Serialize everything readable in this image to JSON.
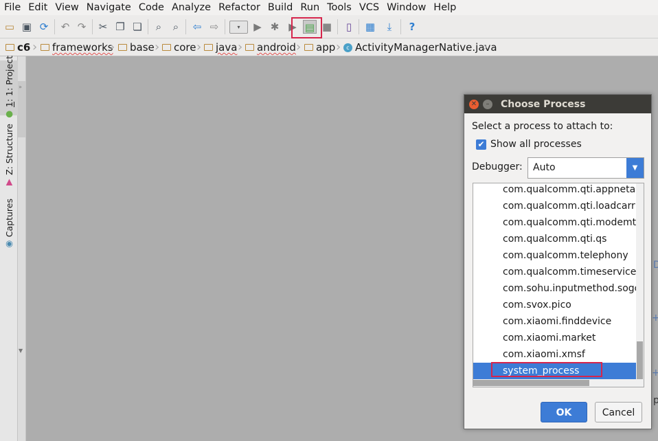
{
  "menu": [
    "File",
    "Edit",
    "View",
    "Navigate",
    "Code",
    "Analyze",
    "Refactor",
    "Build",
    "Run",
    "Tools",
    "VCS",
    "Window",
    "Help"
  ],
  "toolbar_icons": [
    "open-folder-icon",
    "save-icon",
    "sync-icon",
    "undo-icon",
    "redo-icon",
    "cut-icon",
    "copy-icon",
    "paste-icon",
    "find-icon",
    "replace-icon",
    "back-icon",
    "forward-icon",
    "run-config-dropdown",
    "run-icon",
    "debug-icon",
    "run-coverage-icon",
    "attach-debugger-icon",
    "stop-icon",
    "avd-manager-icon",
    "project-structure-icon",
    "sdk-manager-icon",
    "help-icon"
  ],
  "breadcrumbs": [
    "c6",
    "frameworks",
    "base",
    "core",
    "java",
    "android",
    "app",
    "ActivityManagerNative.java"
  ],
  "side_tabs": [
    "1: Project",
    "Z: Structure",
    "Captures"
  ],
  "dialog": {
    "title": "Choose Process",
    "select_label": "Select a process to attach to:",
    "show_all_label": "Show all processes",
    "show_all_checked": true,
    "debugger_label": "Debugger:",
    "debugger_value": "Auto",
    "processes": [
      "com.qualcomm.qti.appnetaccess",
      "com.qualcomm.qti.loadcarrier",
      "com.qualcomm.qti.modemtestmode",
      "com.qualcomm.qti.qs",
      "com.qualcomm.telephony",
      "com.qualcomm.timeservice",
      "com.sohu.inputmethod.sogou",
      "com.svox.pico",
      "com.xiaomi.finddevice",
      "com.xiaomi.market",
      "com.xiaomi.xmsf",
      "system_process"
    ],
    "selected_process": "system_process",
    "ok_label": "OK",
    "cancel_label": "Cancel"
  },
  "colors": {
    "accent": "#3d7cd6",
    "titlebar": "#3c3b37",
    "highlight": "#d6254c",
    "editor_bg": "#adadad"
  }
}
